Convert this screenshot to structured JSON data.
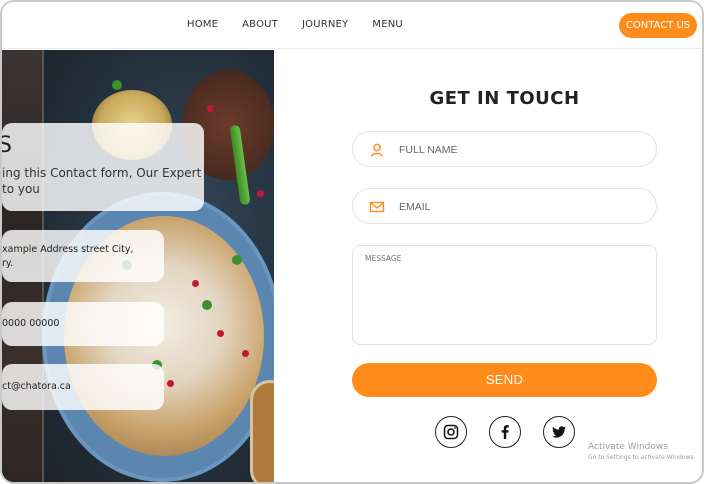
{
  "nav": {
    "links": [
      "HOME",
      "ABOUT",
      "JOURNEY",
      "MENU"
    ],
    "cta": "CONTACT US"
  },
  "hero_card": {
    "title": "S",
    "description": "ing this Contact form, Our Expert\n to you"
  },
  "info": {
    "address": "xample Address street City,\nry.",
    "phone": "0000 00000",
    "email": "ct@chatora.ca"
  },
  "form": {
    "title": "GET IN TOUCH",
    "name_placeholder": "FULL NAME",
    "email_placeholder": "EMAIL",
    "message_placeholder": "MESSAGE",
    "send_label": "SEND"
  },
  "social": [
    "instagram-icon",
    "facebook-icon",
    "twitter-icon"
  ],
  "watermark": {
    "line1": "Activate Windows",
    "line2": "Go to Settings to activate Windows."
  },
  "colors": {
    "accent": "#ff8c1a",
    "text": "#222222",
    "field_border": "#e3e3e3"
  }
}
